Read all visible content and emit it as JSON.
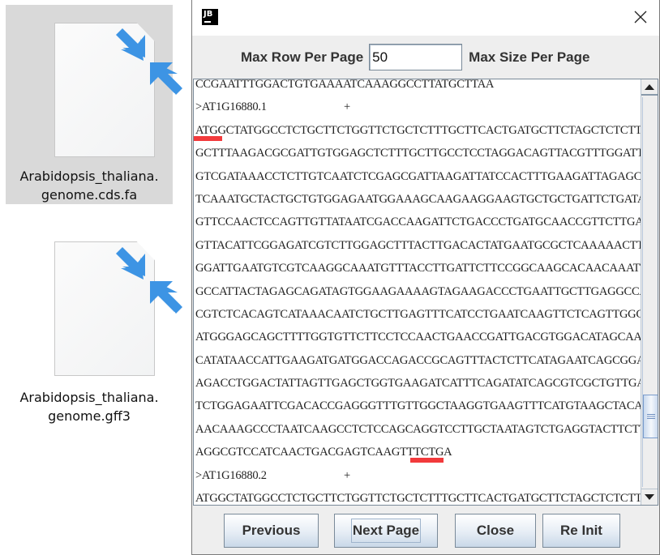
{
  "desktop": {
    "files": [
      {
        "name": "Arabidopsis_thaliana.\ngenome.cds.fa",
        "line1": "Arabidopsis_thaliana.",
        "line2": "genome.cds.fa",
        "icon": "shortcut-file-icon",
        "selected": true
      },
      {
        "name": "Arabidopsis_thaliana.\ngenome.gff3",
        "line1": "Arabidopsis_thaliana.",
        "line2": "genome.gff3",
        "icon": "shortcut-file-icon",
        "selected": false
      }
    ]
  },
  "dialog": {
    "app_icon": "jetbrains-logo-icon",
    "app_icon_text": "JB",
    "close_icon": "close-icon",
    "settings": {
      "max_row_label": "Max Row Per Page",
      "max_row_value": "50",
      "max_size_label": "Max Size Per Page"
    },
    "sequence_lines": [
      {
        "type": "seq",
        "text": "CCGAATTTGGACTGTGAAAATCAAAGGCCTTATGCTTAA"
      },
      {
        "type": "header",
        "id": ">AT1G16880.1",
        "strand": "+"
      },
      {
        "type": "seq",
        "text": "ATGGCTATGGCCTCTGCTTCTGGTTCTGCTCTTTGCTTCACTGATGCTTCTAGCTCTCTT",
        "mark": "start"
      },
      {
        "type": "seq",
        "text": "GCTTTAAGACGCGATTGTGGAGCTCTTTGCTTGCCTCCTAGGACAGTTACGTTTGGATTT"
      },
      {
        "type": "seq",
        "text": "GTCGATAAACCTCTTGTCAATCTCGAGCGATTAAGATTATCCACTTTGAAGATTAGAGCA"
      },
      {
        "type": "seq",
        "text": "TCAAATGCTACTGCTGTGGAGAATGGAAAGCAAGAAGGAAGTGCTGCTGATTCTGATAAA"
      },
      {
        "type": "seq",
        "text": "GTTCCAACTCCAGTTGTTATAATCGACCAAGATTCTGACCCTGATGCAACCGTTCTTGAA"
      },
      {
        "type": "seq",
        "text": "GTTACATTCGGAGATCGTCTTGGAGCTTTACTTGACACTATGAATGCGCTCAAAAACTTG"
      },
      {
        "type": "seq",
        "text": "GGATTGAATGTCGTCAAGGCAAATGTTTACCTTGATTCTTCCGGCAAGCACAACAAATTT"
      },
      {
        "type": "seq",
        "text": "GCCATTACTAGAGCAGATAGTGGAAGAAAAGTAGAAGACCCTGAATTGCTTGAGGCCATT"
      },
      {
        "type": "seq",
        "text": "CGTCTCACAGTCATAAACAATCTGCTTGAGTTTCATCCTGAATCAAGTTCTCAGTTGGCA"
      },
      {
        "type": "seq",
        "text": "ATGGGAGCAGCTTTTGGTGTTCTTCCTCCAACTGAACCGATTGACGTGGACATAGCAACA"
      },
      {
        "type": "seq",
        "text": "CATATAACCATTGAAGATGATGGACCAGACCGCAGTTTACTCTTCATAGAATCAGCGGAT"
      },
      {
        "type": "seq",
        "text": "AGACCTGGACTATTAGTTGAGCTGGTGAAGATCATTTCAGATATCAGCGTCGCTGTTGAA"
      },
      {
        "type": "seq",
        "text": "TCTGGAGAATTCGACACCGAGGGTTTGTTGGCTAAGGTGAAGTTTCATGTAAGCTACAGG"
      },
      {
        "type": "seq",
        "text": "AACAAAGCCCTAATCAAGCCTCTCCAGCAGGTCCTTGCTAATAGTCTGAGGTACTTCTTG"
      },
      {
        "type": "seq",
        "text": "AGGCGTCCATCAACTGACGAGTCAAGTTTCTGA",
        "mark": "stop"
      },
      {
        "type": "header",
        "id": ">AT1G16880.2",
        "strand": "+"
      },
      {
        "type": "seq",
        "text": "ATGGCTATGGCCTCTGCTTCTGGTTCTGCTCTTTGCTTCACTGATGCTTCTAGCTCTCTT"
      }
    ],
    "annotations": {
      "start_codon_mark_color": "#f23a3c",
      "stop_codon_mark_color": "#f23a3c"
    },
    "scrollbar": {
      "position_fraction": 0.86,
      "visible_fraction": 0.14
    },
    "buttons": {
      "previous": "Previous",
      "next_page": "Next Page",
      "close": "Close",
      "re_init": "Re Init"
    }
  }
}
